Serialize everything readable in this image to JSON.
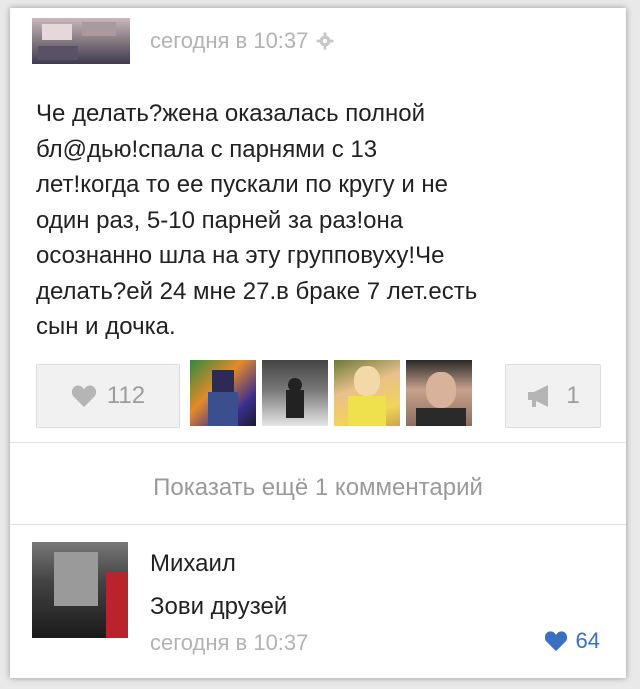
{
  "post": {
    "timestamp": "сегодня в 10:37",
    "text": "Че делать?жена оказалась полной\nбл@дью!спала с парнями с 13\nлет!когда то ее пускали по кругу и не\nодин раз, 5-10 парней за раз!она\nосознанно шла на эту групповуху!Че\nделать?ей 24 мне 27.в браке 7 лет.есть\nсын и дочка.",
    "likes_count": "112",
    "shares_count": "1"
  },
  "show_more_label": "Показать ещё 1 комментарий",
  "comment": {
    "author": "Михаил",
    "text": "Зови друзей",
    "timestamp": "сегодня в 10:37",
    "likes_count": "64"
  },
  "icons": {
    "gear": "gear-icon",
    "heart": "heart-icon",
    "megaphone": "megaphone-icon",
    "comment_heart": "heart-icon"
  },
  "colors": {
    "accent_blue": "#3a6fc4",
    "muted_text": "#b3b3b3",
    "button_bg": "#f1f1f1"
  }
}
